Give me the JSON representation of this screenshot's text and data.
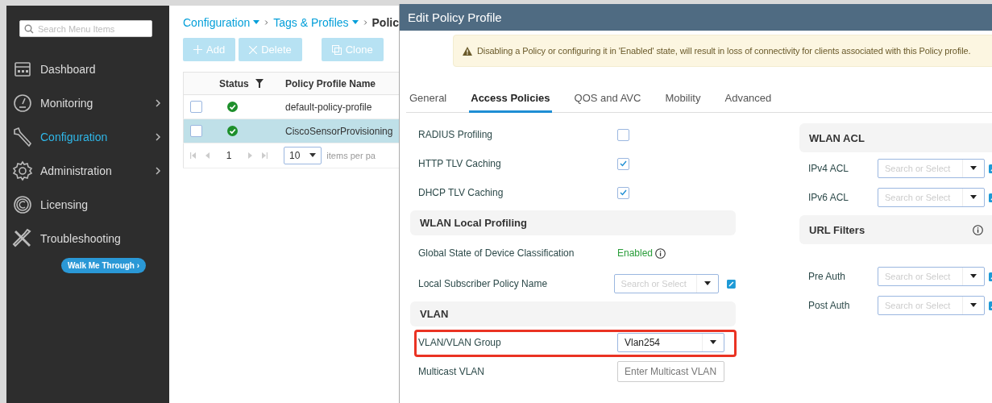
{
  "sidebar": {
    "search_placeholder": "Search Menu Items",
    "items": [
      {
        "label": "Dashboard",
        "kind": "dashboard",
        "selected": false,
        "submenu": false
      },
      {
        "label": "Monitoring",
        "kind": "gauge",
        "selected": false,
        "submenu": true
      },
      {
        "label": "Configuration",
        "kind": "wrench",
        "selected": true,
        "submenu": true
      },
      {
        "label": "Administration",
        "kind": "gear",
        "selected": false,
        "submenu": true
      },
      {
        "label": "Licensing",
        "kind": "license",
        "selected": false,
        "submenu": false
      },
      {
        "label": "Troubleshooting",
        "kind": "tools",
        "selected": false,
        "submenu": false
      }
    ],
    "walk_button": "Walk Me Through ›"
  },
  "breadcrumb": [
    {
      "label": "Configuration",
      "dropdown": true
    },
    {
      "label": "Tags & Profiles",
      "dropdown": true
    },
    {
      "label": "Polic",
      "dropdown": false
    }
  ],
  "toolbar": [
    {
      "label": "Add",
      "kind": "add",
      "disabled": true
    },
    {
      "label": "Delete",
      "kind": "delete",
      "disabled": true
    },
    {
      "label": "Clone",
      "kind": "clone",
      "disabled": true
    }
  ],
  "table": {
    "columns": [
      "Status",
      "Policy Profile Name"
    ],
    "rows": [
      {
        "checked": false,
        "kind": "ok",
        "name": "default-policy-profile",
        "selected": false
      },
      {
        "checked": false,
        "kind": "ok",
        "name": "CiscoSensorProvisioning",
        "selected": true
      }
    ],
    "pager": {
      "page": "1",
      "page_size": "10",
      "label": "items per pa"
    }
  },
  "modal": {
    "title": "Edit Policy Profile",
    "warning": "Disabling a Policy or configuring it in 'Enabled' state, will result in loss of connectivity for clients associated with this Policy profile.",
    "tabs": [
      {
        "label": "General",
        "selected": false
      },
      {
        "label": "Access Policies",
        "selected": true
      },
      {
        "label": "QOS and AVC",
        "selected": false
      },
      {
        "label": "Mobility",
        "selected": false
      },
      {
        "label": "Advanced",
        "selected": false
      }
    ],
    "left": [
      {
        "kind": "checkbox",
        "label": "RADIUS Profiling",
        "checked": false
      },
      {
        "kind": "checkbox",
        "label": "HTTP TLV Caching",
        "checked": true
      },
      {
        "kind": "checkbox",
        "label": "DHCP TLV Caching",
        "checked": true
      },
      {
        "kind": "section",
        "label": "WLAN Local Profiling"
      },
      {
        "kind": "status",
        "label": "Global State of Device Classification",
        "value": "Enabled"
      },
      {
        "kind": "select",
        "label": "Local Subscriber Policy Name",
        "placeholder": "Search or Select",
        "edit_icon": true
      },
      {
        "kind": "section",
        "label": "VLAN"
      },
      {
        "kind": "select",
        "label": "VLAN/VLAN Group",
        "value": "Vlan254",
        "highlighted": true
      },
      {
        "kind": "input",
        "label": "Multicast VLAN",
        "placeholder": "Enter Multicast VLAN"
      }
    ],
    "right": [
      {
        "kind": "section",
        "label": "WLAN ACL"
      },
      {
        "kind": "select",
        "label": "IPv4 ACL",
        "placeholder": "Search or Select",
        "edit_icon": true
      },
      {
        "kind": "select",
        "label": "IPv6 ACL",
        "placeholder": "Search or Select",
        "edit_icon": true
      },
      {
        "kind": "section",
        "label": "URL Filters",
        "info": true
      },
      {
        "kind": "spacer"
      },
      {
        "kind": "select",
        "label": "Pre Auth",
        "placeholder": "Search or Select",
        "edit_icon": true
      },
      {
        "kind": "select",
        "label": "Post Auth",
        "placeholder": "Search or Select",
        "edit_icon": true
      }
    ]
  }
}
